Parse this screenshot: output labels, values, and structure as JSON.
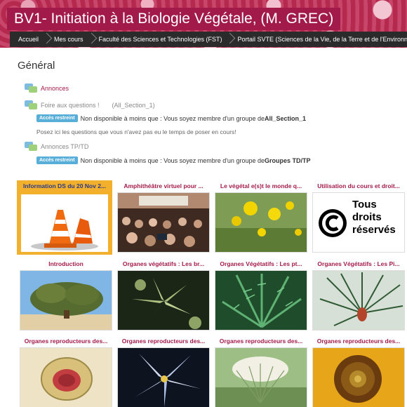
{
  "header": {
    "course_title": "BV1- Initiation à la Biologie Végétale, (M. GREC)",
    "breadcrumbs": [
      "Accueil",
      "Mes cours",
      "Faculté des Sciences et Technologies (FST)",
      "Portail SVTE (Sciences de la Vie, de la Terre et de l'Environn"
    ]
  },
  "section": {
    "title": "Général",
    "activities": [
      {
        "label": "Annonces",
        "icon": "forum-icon"
      },
      {
        "label": "Foire aux questions !",
        "tag": "(All_Section_1)",
        "icon": "forum-icon",
        "restriction": {
          "badge": "Accès restreint",
          "text": "Non disponible à moins que : Vous soyez membre d'un groupe de ",
          "group": "All_Section_1"
        },
        "description": "Posez ici les questions que vous n'avez pas eu le temps de poser en cours!"
      },
      {
        "label": "Annonces TP/TD",
        "icon": "forum-icon",
        "restriction": {
          "badge": "Accès restreint",
          "text": "Non disponible à moins que : Vous soyez membre d'un groupe de ",
          "group": "Groupes TD/TP"
        }
      }
    ]
  },
  "tiles": [
    {
      "title": "Information DS du 20 Nov 2...",
      "image": "traffic-cones",
      "active": true
    },
    {
      "title": "Amphithéâtre virtuel pour ...",
      "image": "lecture-hall"
    },
    {
      "title": "Le végétal e(s)t le monde q...",
      "image": "yellow-flowers"
    },
    {
      "title": "Utilisation du cours et droit...",
      "image": "copyright",
      "image_text": "Tous droits réservés"
    },
    {
      "title": "Introduction",
      "image": "tree"
    },
    {
      "title": "Organes végétatifs : Les br...",
      "image": "succulent"
    },
    {
      "title": "Organes Végétatifs : Les pt...",
      "image": "fern"
    },
    {
      "title": "Organes Végétatifs : Les Pi...",
      "image": "pine-needles"
    },
    {
      "title": "Organes reproducteurs des...",
      "image": "ovary-section"
    },
    {
      "title": "Organes reproducteurs des...",
      "image": "lily"
    },
    {
      "title": "Organes reproducteurs des...",
      "image": "umbel"
    },
    {
      "title": "Organes reproducteurs des...",
      "image": "sunflower"
    }
  ],
  "colors": {
    "accent": "#a21a4a",
    "banner": "#b52a52",
    "badge": "#57aed8",
    "active_tile": "#f2b02c"
  }
}
